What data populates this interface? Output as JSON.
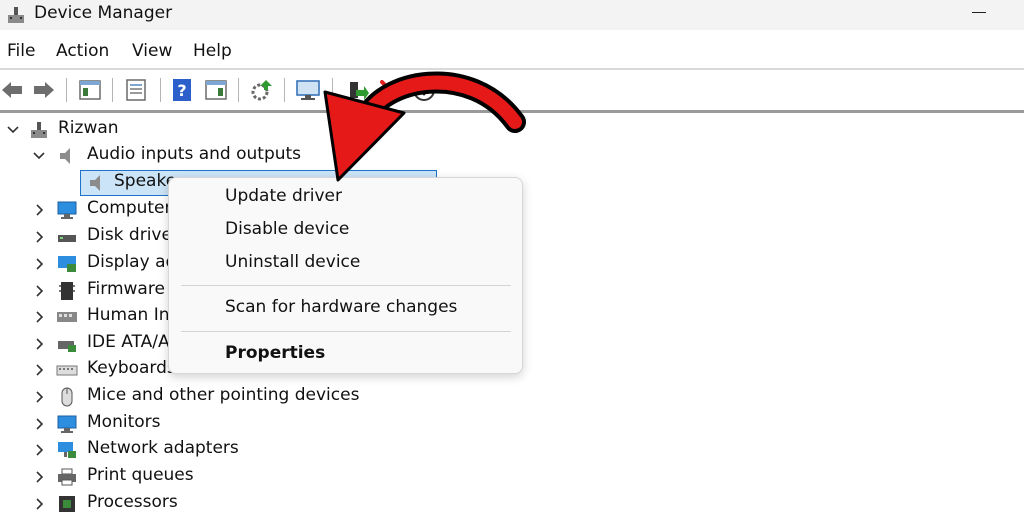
{
  "window": {
    "title": "Device Manager"
  },
  "menu": [
    "File",
    "Action",
    "View",
    "Help"
  ],
  "toolbar": {
    "icons": [
      "back-arrow-icon",
      "forward-arrow-icon",
      "show-hide-tree-icon",
      "properties-sheet-icon",
      "help-icon",
      "action-pane-icon",
      "update-driver-icon",
      "scan-monitor-icon",
      "enable-device-icon",
      "uninstall-x-icon",
      "download-circle-icon"
    ]
  },
  "tree": {
    "root": "Rizwan",
    "audio": "Audio inputs and outputs",
    "selected": "Speake",
    "categories": [
      "Computer",
      "Disk drives",
      "Display ad",
      "Firmware",
      "Human Int",
      "IDE ATA/AT",
      "Keyboards",
      "Mice and other pointing devices",
      "Monitors",
      "Network adapters",
      "Print queues",
      "Processors"
    ]
  },
  "context_menu": {
    "update": "Update driver",
    "disable": "Disable device",
    "uninstall": "Uninstall device",
    "scan": "Scan for hardware changes",
    "properties": "Properties"
  },
  "colors": {
    "selection": "#cce4f7",
    "arrow": "#e61919",
    "uninstall_x": "#e02020"
  }
}
